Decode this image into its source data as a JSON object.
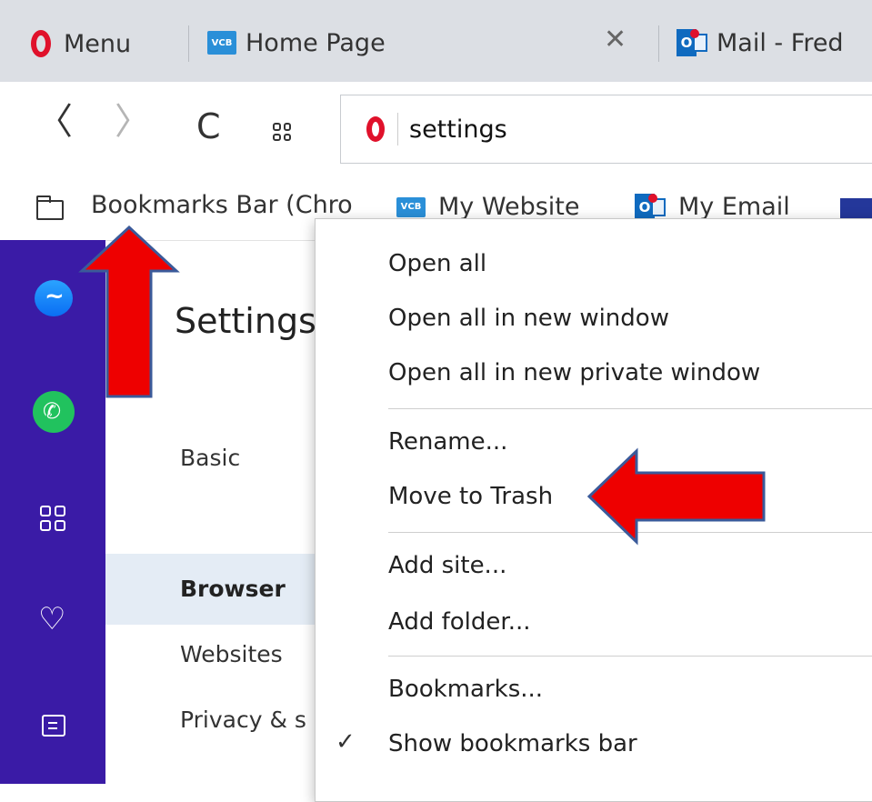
{
  "tabs": {
    "menu_label": "Menu",
    "items": [
      {
        "icon": "vcb-icon",
        "label": "Home Page"
      },
      {
        "icon": "outlook-icon",
        "label": "Mail - Fred"
      }
    ],
    "close_glyph": "✕"
  },
  "navbar": {
    "back_glyph": "〈",
    "forward_glyph": "〉",
    "reload_glyph": "C",
    "url_text": "settings"
  },
  "bookmarks_bar": {
    "folder_label": "Bookmarks Bar (Chro",
    "items": [
      {
        "icon": "vcb-icon",
        "label": "My Website"
      },
      {
        "icon": "outlook-icon",
        "label": "My Email"
      }
    ]
  },
  "settings": {
    "title": "Settings",
    "nav": [
      "Basic",
      "Browser",
      "Websites",
      "Privacy & s"
    ],
    "selected": "Browser"
  },
  "context_menu": {
    "items": [
      "Open all",
      "Open all in new window",
      "Open all in new private window",
      "Rename...",
      "Move to Trash",
      "Add site...",
      "Add folder...",
      "Bookmarks...",
      "Show bookmarks bar"
    ],
    "checked_item": "Show bookmarks bar",
    "check_glyph": "✓"
  },
  "icons": {
    "vcb_text": "VCB",
    "outlook_text": "O"
  },
  "colors": {
    "sidebar": "#3a1ba6",
    "opera_red": "#e0112b",
    "annotation_arrow": "#ee0000",
    "selected_nav": "#e4ecf5"
  }
}
